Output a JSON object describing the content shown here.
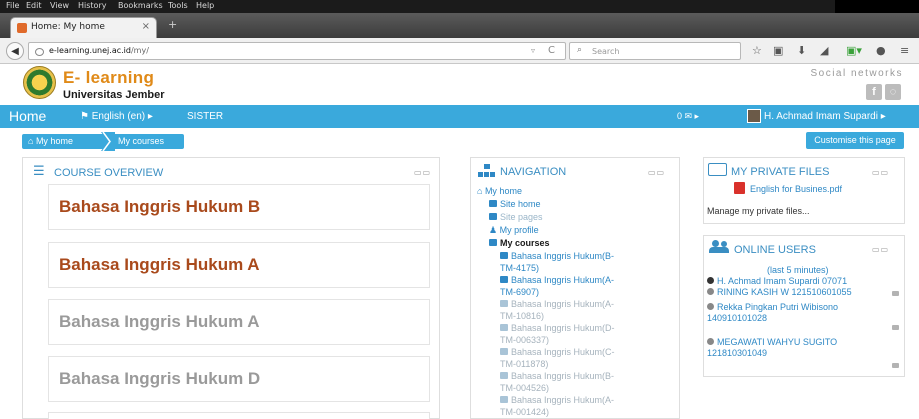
{
  "browser": {
    "menu": [
      "File",
      "Edit",
      "View",
      "History",
      "Bookmarks",
      "Tools",
      "Help"
    ],
    "tab_title": "Home: My home",
    "tab_close": "×",
    "new_tab": "+",
    "url_host": "e-learning.unej.ac.id",
    "url_path": "/my/",
    "url_dropdown": "▿",
    "reload_icon": "C",
    "search_placeholder": "Search",
    "toolbar_icons": [
      "star-icon",
      "reading-list-icon",
      "download-icon",
      "send-icon",
      "addon-icon",
      "menu-icon"
    ]
  },
  "site": {
    "brand": "E- learning",
    "university": "Universitas Jember",
    "social_label": "Social networks",
    "social_icons": [
      "facebook-icon",
      "other-social-icon"
    ]
  },
  "mainnav": {
    "home": "Home",
    "language": "English (en) ▸",
    "sister": "SISTER",
    "messages": "0 ✉ ▸",
    "user": "H. Achmad Imam Supardi ▸"
  },
  "breadcrumb": {
    "my_home": "My home",
    "my_courses": "My courses"
  },
  "customise_button": "Customise this page",
  "course_overview": {
    "title": "COURSE OVERVIEW",
    "controls": "▭▭",
    "courses": [
      {
        "name": "Bahasa Inggris Hukum B",
        "color": "#a94a1c"
      },
      {
        "name": "Bahasa Inggris Hukum A",
        "color": "#a94a1c"
      },
      {
        "name": "Bahasa Inggris Hukum A",
        "color": "#9a9a9a"
      },
      {
        "name": "Bahasa Inggris Hukum D",
        "color": "#9a9a9a"
      }
    ]
  },
  "navigation": {
    "title": "NAVIGATION",
    "controls": "▭▭",
    "my_home": "My home",
    "site_home": "Site home",
    "site_pages": "Site pages",
    "my_profile": "My profile",
    "my_courses": "My courses",
    "courses": [
      {
        "line1": "Bahasa Inggris Hukum(B-",
        "line2": "TM-4175)",
        "dim": false
      },
      {
        "line1": "Bahasa Inggris Hukum(A-",
        "line2": "TM-6907)",
        "dim": false
      },
      {
        "line1": "Bahasa Inggris Hukum(A-",
        "line2": "TM-10816)",
        "dim": true
      },
      {
        "line1": "Bahasa Inggris Hukum(D-",
        "line2": "TM-006337)",
        "dim": true
      },
      {
        "line1": "Bahasa Inggris Hukum(C-",
        "line2": "TM-011878)",
        "dim": true
      },
      {
        "line1": "Bahasa Inggris Hukum(B-",
        "line2": "TM-004526)",
        "dim": true
      },
      {
        "line1": "Bahasa Inggris Hukum(A-",
        "line2": "TM-001424)",
        "dim": true
      }
    ]
  },
  "private_files": {
    "title": "MY PRIVATE FILES",
    "controls": "▭▭",
    "file": "English for Busines.pdf",
    "manage": "Manage my private files..."
  },
  "online_users": {
    "title": "ONLINE USERS",
    "controls": "▭▭",
    "subtitle": "(last 5 minutes)",
    "users": [
      {
        "name": "H. Achmad Imam Supardi 07071"
      },
      {
        "name": "RINING KASIH W 121510601055"
      },
      {
        "name": "Rekka Pingkan Putri Wibisono",
        "line2": "140910101028"
      },
      {
        "name": "MEGAWATI WAHYU SUGITO",
        "line2": "121810301049"
      }
    ]
  }
}
